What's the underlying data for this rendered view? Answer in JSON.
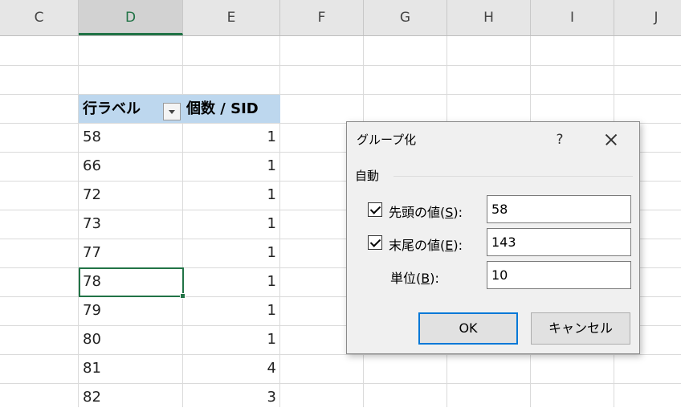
{
  "columns": [
    "C",
    "D",
    "E",
    "F",
    "G",
    "H",
    "I",
    "J"
  ],
  "selected_column": "D",
  "pivot": {
    "row_label_header": "行ラベル",
    "value_header": "個数 / SID",
    "rows": [
      {
        "key": "58",
        "value": "1"
      },
      {
        "key": "66",
        "value": "1"
      },
      {
        "key": "72",
        "value": "1"
      },
      {
        "key": "73",
        "value": "1"
      },
      {
        "key": "77",
        "value": "1"
      },
      {
        "key": "78",
        "value": "1"
      },
      {
        "key": "79",
        "value": "1"
      },
      {
        "key": "80",
        "value": "1"
      },
      {
        "key": "81",
        "value": "4"
      },
      {
        "key": "82",
        "value": "3"
      }
    ]
  },
  "dialog": {
    "title": "グループ化",
    "help_label": "?",
    "group_label": "自動",
    "start": {
      "label_pre": "先頭の値(",
      "hotkey": "S",
      "label_post": "):",
      "value": "58",
      "checked": true
    },
    "end": {
      "label_pre": "末尾の値(",
      "hotkey": "E",
      "label_post": "):",
      "value": "143",
      "checked": true
    },
    "unit": {
      "label_pre": "単位(",
      "hotkey": "B",
      "label_post": "):",
      "value": "10"
    },
    "ok_label": "OK",
    "cancel_label": "キャンセル"
  },
  "colors": {
    "accent": "#217346",
    "pivot_header": "#bdd7ee",
    "focus": "#0078d7"
  }
}
